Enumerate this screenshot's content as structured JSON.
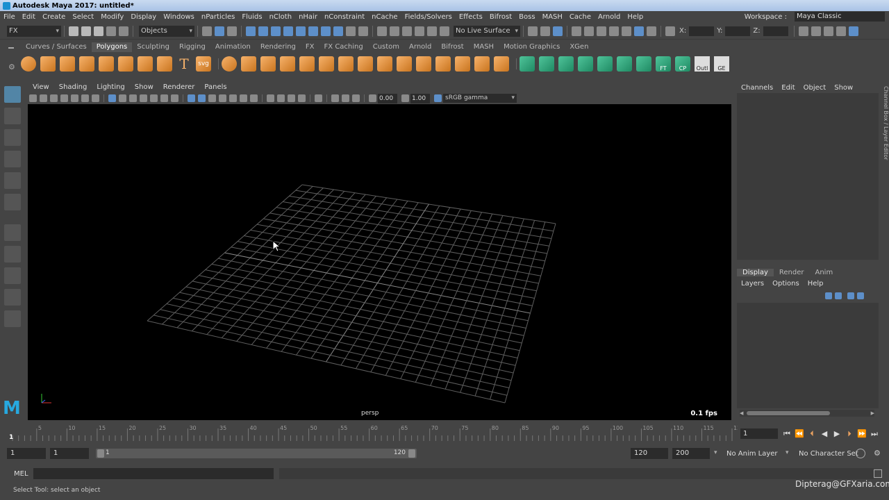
{
  "window": {
    "title": "Autodesk Maya 2017: untitled*"
  },
  "menubar": {
    "items": [
      "File",
      "Edit",
      "Create",
      "Select",
      "Modify",
      "Display",
      "Windows",
      "nParticles",
      "Fluids",
      "nCloth",
      "nHair",
      "nConstraint",
      "nCache",
      "Fields/Solvers",
      "Effects",
      "Bifrost",
      "Boss",
      "MASH",
      "Cache",
      "Arnold",
      "Help"
    ],
    "workspace_label": "Workspace :",
    "workspace_value": "Maya Classic"
  },
  "statusline": {
    "menuset": "FX",
    "selection_mode": "Objects",
    "live_surface": "No Live Surface",
    "x_label": "X:",
    "y_label": "Y:",
    "z_label": "Z:"
  },
  "shelf": {
    "tabs": [
      "Curves / Surfaces",
      "Polygons",
      "Sculpting",
      "Rigging",
      "Animation",
      "Rendering",
      "FX",
      "FX Caching",
      "Custom",
      "Arnold",
      "Bifrost",
      "MASH",
      "Motion Graphics",
      "XGen"
    ],
    "active_tab": "Polygons",
    "icon_labels": {
      "ft": "FT",
      "cp": "CP",
      "outl": "Outl",
      "ge": "GE",
      "svg": "svg",
      "text": "T"
    }
  },
  "viewport": {
    "menu": [
      "View",
      "Shading",
      "Lighting",
      "Show",
      "Renderer",
      "Panels"
    ],
    "exposure": "0.00",
    "gamma": "1.00",
    "color_space": "sRGB gamma",
    "camera": "persp",
    "fps": "0.1 fps"
  },
  "channelbox": {
    "menu": [
      "Channels",
      "Edit",
      "Object",
      "Show"
    ],
    "vertical_label": "Channel Box / Layer Editor"
  },
  "layereditor": {
    "tabs": [
      "Display",
      "Render",
      "Anim"
    ],
    "active_tab": "Display",
    "menu": [
      "Layers",
      "Options",
      "Help"
    ]
  },
  "timeslider": {
    "ticks": [
      "5",
      "10",
      "15",
      "20",
      "25",
      "30",
      "35",
      "40",
      "45",
      "50",
      "55",
      "60",
      "65",
      "70",
      "75",
      "80",
      "85",
      "90",
      "95",
      "100",
      "105",
      "110",
      "115",
      "120"
    ],
    "start_label": "1",
    "current_frame": "1"
  },
  "rangeslider": {
    "start": "1",
    "playback_start": "1",
    "range_start": "1",
    "range_end": "120",
    "playback_end": "120",
    "end": "200",
    "anim_layer": "No Anim Layer",
    "character_set": "No Character Set"
  },
  "commandline": {
    "label": "MEL"
  },
  "helpline": {
    "text": "Select Tool: select an object"
  },
  "watermark": {
    "text": "Dipterag@GFXaria.com"
  }
}
